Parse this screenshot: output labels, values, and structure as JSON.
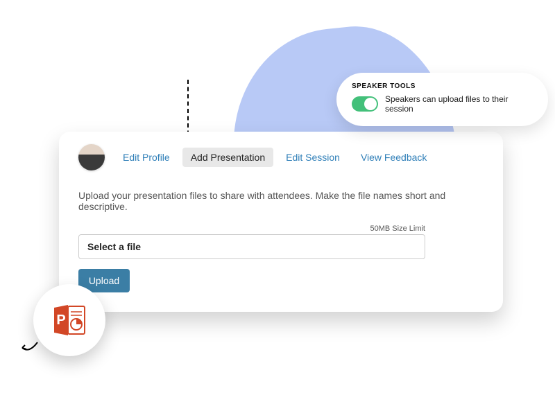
{
  "speaker_tools": {
    "title": "SPEAKER TOOLS",
    "toggle_label": "Speakers can upload files to their session",
    "toggle_on": true
  },
  "tabs": {
    "edit_profile": "Edit Profile",
    "add_presentation": "Add Presentation",
    "edit_session": "Edit Session",
    "view_feedback": "View Feedback"
  },
  "upload": {
    "instructions": "Upload your presentation files to share with attendees. Make the file names short and descriptive.",
    "size_limit": "50MB Size Limit",
    "file_placeholder": "Select a file",
    "button_label": "Upload"
  },
  "icons": {
    "powerpoint": "powerpoint-icon"
  }
}
